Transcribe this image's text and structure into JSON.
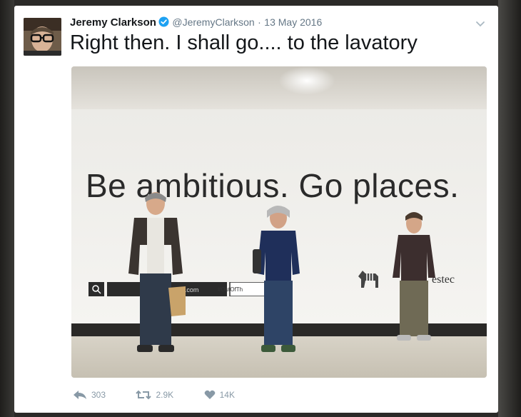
{
  "tweet": {
    "author_name": "Jeremy Clarkson",
    "handle": "@JeremyClarkson",
    "separator": "·",
    "date": "13 May 2016",
    "text": "Right then. I shall go.... to the lavatory"
  },
  "media": {
    "slogan": "Be ambitious. Go places.",
    "brand": "estec",
    "search_url_fragment": "y.com",
    "hashtag": "#OutOfTh"
  },
  "actions": {
    "reply_count": "303",
    "retweet_count": "2.9K",
    "like_count": "14K"
  },
  "icons": {
    "verified": "verified-badge-icon",
    "menu": "chevron-down-icon",
    "reply": "reply-icon",
    "retweet": "retweet-icon",
    "like": "heart-icon"
  },
  "colors": {
    "verified_blue": "#1da1f2",
    "meta_gray": "#657786",
    "action_gray": "#8899a6"
  }
}
